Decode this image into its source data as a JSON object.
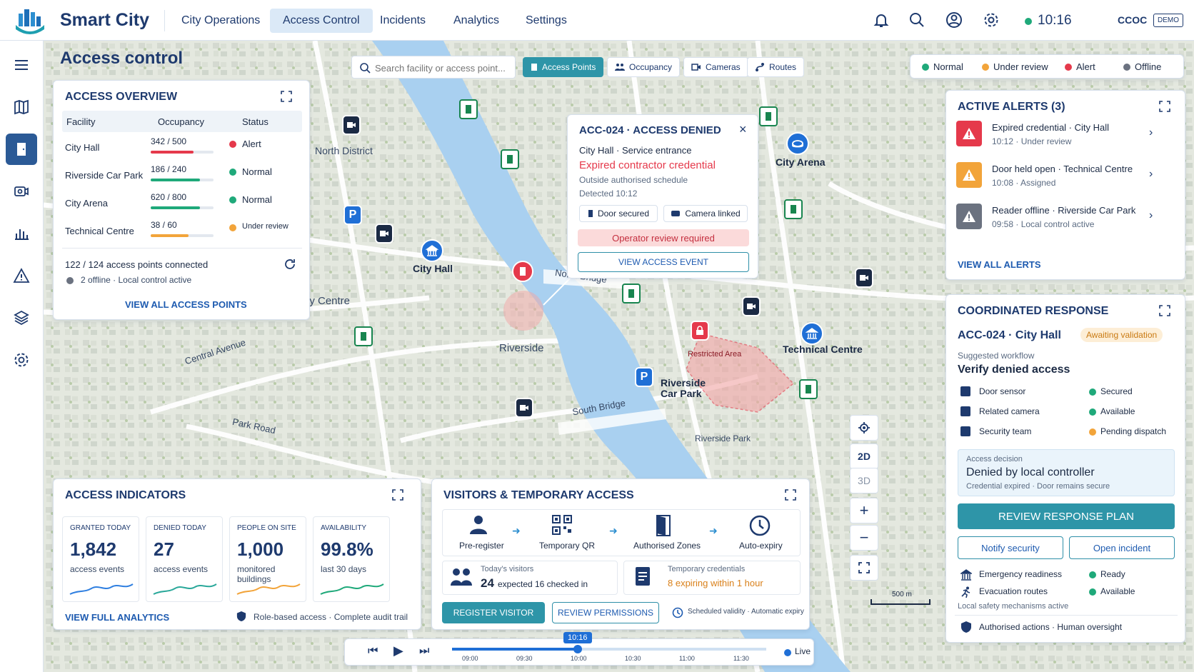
{
  "app": {
    "brand": "Smart City",
    "clock": "10:16",
    "org": "CCOC",
    "badge": "DEMO"
  },
  "nav": [
    "City Operations",
    "Access Control",
    "Incidents",
    "Analytics",
    "Settings"
  ],
  "page": {
    "title": "Access control"
  },
  "search": {
    "placeholder": "Search facility or access point..."
  },
  "layers": [
    "Access Points",
    "Occupancy",
    "Cameras",
    "Routes"
  ],
  "legend": [
    {
      "label": "Normal",
      "color": "#1fa97a"
    },
    {
      "label": "Under review",
      "color": "#f2a43a"
    },
    {
      "label": "Alert",
      "color": "#e5394b"
    },
    {
      "label": "Offline",
      "color": "#6b7280"
    }
  ],
  "overview": {
    "title": "ACCESS OVERVIEW",
    "cols": [
      "Facility",
      "Occupancy",
      "Status"
    ],
    "rows": [
      {
        "facility": "City Hall",
        "occ": "342 / 500",
        "status": "Alert",
        "fill": 0.68,
        "color": "#e5394b"
      },
      {
        "facility": "Riverside Car Park",
        "occ": "186 / 240",
        "status": "Normal",
        "fill": 0.78,
        "color": "#1fa97a"
      },
      {
        "facility": "City Arena",
        "occ": "620 / 800",
        "status": "Normal",
        "fill": 0.78,
        "color": "#1fa97a"
      },
      {
        "facility": "Technical Centre",
        "occ": "38 / 60",
        "status": "Under review",
        "fill": 0.6,
        "color": "#f2a43a"
      }
    ],
    "connected": "122 / 124 access points connected",
    "offline": "2 offline · Local control active",
    "link": "VIEW ALL ACCESS POINTS"
  },
  "popup": {
    "title": "ACC-024 · ACCESS DENIED",
    "location": "City Hall  ·  Service entrance",
    "reason": "Expired contractor credential",
    "schedule": "Outside authorised schedule",
    "detected": "Detected 10:12",
    "chip1": "Door secured",
    "chip2": "Camera linked",
    "warning": "Operator review required",
    "button": "VIEW ACCESS EVENT"
  },
  "map": {
    "areas": [
      "North District",
      "City Centre",
      "Riverside",
      "Riverside Park"
    ],
    "roads": [
      "North Bridge",
      "Central Avenue",
      "Park Road",
      "South Bridge"
    ],
    "places": [
      "City Hall",
      "City Arena",
      "Technical Centre",
      "Riverside Car Park",
      "Restricted Area"
    ],
    "scale": "500 m",
    "controls": [
      "2D",
      "3D"
    ]
  },
  "alerts": {
    "title": "ACTIVE ALERTS (3)",
    "items": [
      {
        "title": "Expired credential · City Hall",
        "sub": "10:12  ·  Under review",
        "color": "#e5394b"
      },
      {
        "title": "Door held open · Technical Centre",
        "sub": "10:08  ·  Assigned",
        "color": "#f2a43a"
      },
      {
        "title": "Reader offline · Riverside Car Park",
        "sub": "09:58  ·  Local control active",
        "color": "#6b7280"
      }
    ],
    "link": "VIEW ALL ALERTS"
  },
  "response": {
    "title": "COORDINATED RESPONSE",
    "ref": "ACC-024  ·  City Hall",
    "badge": "Awaiting validation",
    "suggested": "Suggested workflow",
    "workflow": "Verify denied access",
    "checks": [
      {
        "label": "Door sensor",
        "status": "Secured",
        "color": "#1fa97a"
      },
      {
        "label": "Related camera",
        "status": "Available",
        "color": "#1fa97a"
      },
      {
        "label": "Security team",
        "status": "Pending dispatch",
        "color": "#f2a43a"
      }
    ],
    "decision_label": "Access decision",
    "decision": "Denied by local controller",
    "decision_sub": "Credential expired  ·  Door remains secure",
    "primary": "REVIEW RESPONSE PLAN",
    "btn1": "Notify security",
    "btn2": "Open incident",
    "readiness": [
      {
        "label": "Emergency readiness",
        "status": "Ready"
      },
      {
        "label": "Evacuation routes",
        "status": "Available"
      }
    ],
    "safety": "Local safety mechanisms active",
    "footer": "Authorised actions · Human oversight"
  },
  "indicators": {
    "title": "ACCESS INDICATORS",
    "kpis": [
      {
        "label": "GRANTED TODAY",
        "value": "1,842",
        "sub": "access events",
        "color": "#2f7fe0"
      },
      {
        "label": "DENIED TODAY",
        "value": "27",
        "sub": "access events",
        "color": "#2aa89a"
      },
      {
        "label": "PEOPLE ON SITE",
        "value": "1,000",
        "sub": "monitored buildings",
        "color": "#f2a43a"
      },
      {
        "label": "AVAILABILITY",
        "value": "99.8%",
        "sub": "last 30 days",
        "color": "#1fa97a"
      }
    ],
    "link": "VIEW FULL ANALYTICS",
    "footer": "Role-based access  ·  Complete audit trail"
  },
  "visitors": {
    "title": "VISITORS & TEMPORARY ACCESS",
    "steps": [
      "Pre-register",
      "Temporary QR",
      "Authorised Zones",
      "Auto-expiry"
    ],
    "today_label": "Today's visitors",
    "expected": "24",
    "expected_suffix": "expected",
    "checked": "16 checked in",
    "temp_label": "Temporary credentials",
    "expiring": "8 expiring within 1 hour",
    "btn1": "REGISTER VISITOR",
    "btn2": "REVIEW PERMISSIONS",
    "validity": "Scheduled validity · Automatic expiry"
  },
  "timeline": {
    "current": "10:16",
    "ticks": [
      "09:00",
      "09:30",
      "10:00",
      "10:30",
      "11:00",
      "11:30"
    ],
    "live": "Live",
    "position": 0.4
  }
}
